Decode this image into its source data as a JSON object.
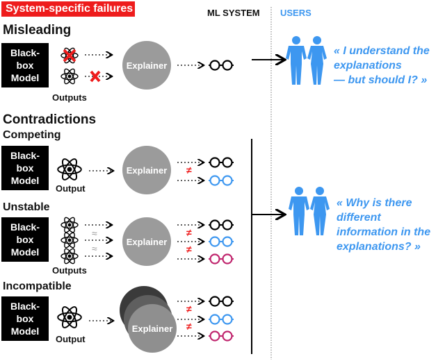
{
  "banner": {
    "label": "System-specific failures",
    "color": "#ee1c1c"
  },
  "columns": {
    "system": "ML SYSTEM",
    "users": "USERS"
  },
  "colors": {
    "black_box": "#000000",
    "explainer": "#9b9b9b",
    "user_blue": "#3d97f0",
    "glasses_black": "#000000",
    "glasses_blue": "#3d97f0",
    "glasses_magenta": "#c0266e",
    "failure_red": "#ee1c1c"
  },
  "misleading": {
    "title": "Misleading",
    "model_lines": [
      "Black-",
      "box",
      "Model"
    ],
    "outputs_label": "Outputs",
    "explainer_label": "Explainer",
    "quote": [
      "« I understand the",
      "explanations",
      "— but should I? »"
    ]
  },
  "contradictions": {
    "title": "Contradictions",
    "competing": {
      "title": "Competing",
      "model_lines": [
        "Black-",
        "box",
        "Model"
      ],
      "output_label": "Output",
      "explainer_label": "Explainer",
      "neq": [
        "≠"
      ]
    },
    "unstable": {
      "title": "Unstable",
      "model_lines": [
        "Black-",
        "box",
        "Model"
      ],
      "outputs_label": "Outputs",
      "explainer_label": "Explainer",
      "approx": [
        "≈",
        "≈"
      ],
      "neq": [
        "≠",
        "≠"
      ]
    },
    "incompatible": {
      "title": "Incompatible",
      "model_lines": [
        "Black-",
        "box",
        "Model"
      ],
      "output_label": "Output",
      "explainer_label": "Explainer",
      "neq": [
        "≠",
        "≠"
      ]
    },
    "quote": [
      "« Why is there",
      "different",
      "information in the",
      "explanations? »"
    ]
  },
  "icons": {
    "output": "atom-icon",
    "explanation": "glasses-icon",
    "failure": "red-x-icon",
    "users": "people-silhouette-icon"
  }
}
